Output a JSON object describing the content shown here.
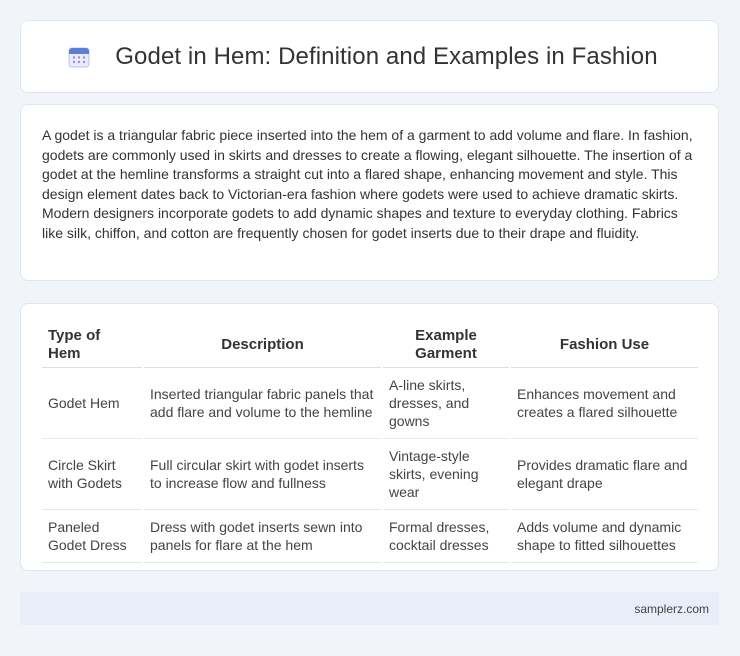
{
  "header": {
    "title": "Godet in Hem: Definition and Examples in Fashion",
    "icon": "calendar-icon",
    "icon_color": "#5b7fd6"
  },
  "intro": {
    "text": "A godet is a triangular fabric piece inserted into the hem of a garment to add volume and flare. In fashion, godets are commonly used in skirts and dresses to create a flowing, elegant silhouette. The insertion of a godet at the hemline transforms a straight cut into a flared shape, enhancing movement and style. This design element dates back to Victorian-era fashion where godets were used to achieve dramatic skirts. Modern designers incorporate godets to add dynamic shapes and texture to everyday clothing. Fabrics like silk, chiffon, and cotton are frequently chosen for godet inserts due to their drape and fluidity."
  },
  "table": {
    "headers": [
      "Type of Hem",
      "Description",
      "Example Garment",
      "Fashion Use"
    ],
    "rows": [
      [
        "Godet Hem",
        "Inserted triangular fabric panels that add flare and volume to the hemline",
        "A-line skirts, dresses, and gowns",
        "Enhances movement and creates a flared silhouette"
      ],
      [
        "Circle Skirt with Godets",
        "Full circular skirt with godet inserts to increase flow and fullness",
        "Vintage-style skirts, evening wear",
        "Provides dramatic flare and elegant drape"
      ],
      [
        "Paneled Godet Dress",
        "Dress with godet inserts sewn into panels for flare at the hem",
        "Formal dresses, cocktail dresses",
        "Adds volume and dynamic shape to fitted silhouettes"
      ]
    ]
  },
  "footer": {
    "link": "samplerz.com"
  }
}
